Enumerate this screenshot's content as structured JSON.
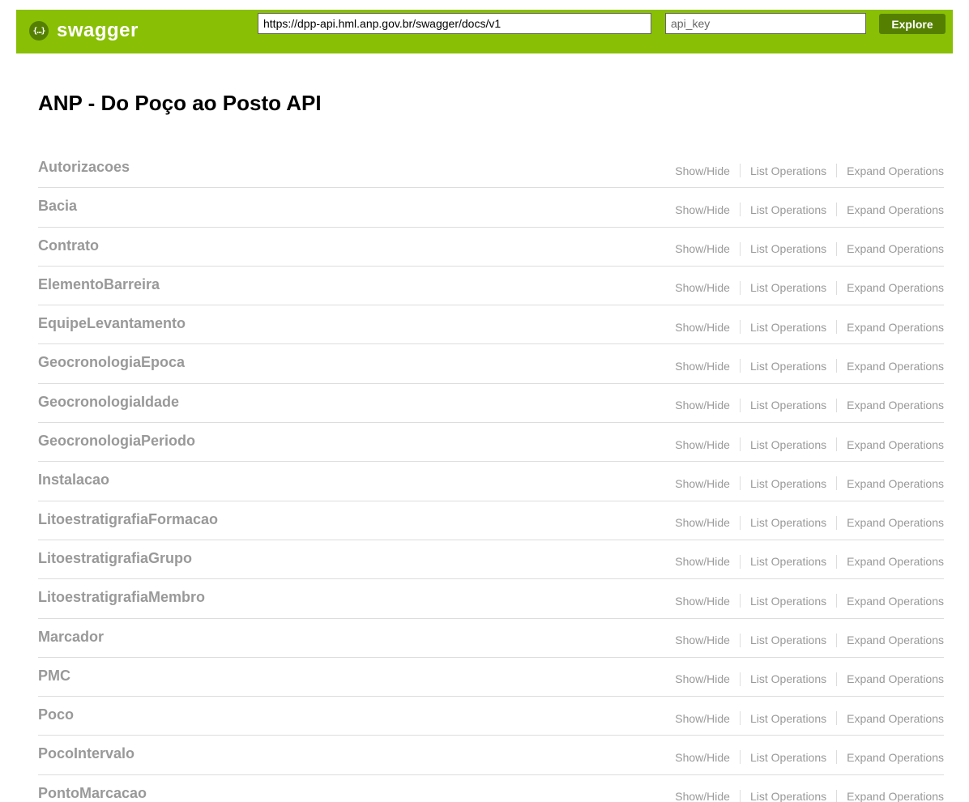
{
  "header": {
    "logo_text": "swagger",
    "logo_icon_text": "{…}",
    "url_value": "https://dpp-api.hml.anp.gov.br/swagger/docs/v1",
    "api_key_placeholder": "api_key",
    "explore_label": "Explore",
    "bar_color": "#89bf04",
    "accent_color": "#547f00"
  },
  "title": "ANP - Do Poço ao Posto API",
  "operation_labels": {
    "show_hide": "Show/Hide",
    "list_operations": "List Operations",
    "expand_operations": "Expand Operations"
  },
  "resources": [
    "Autorizacoes",
    "Bacia",
    "Contrato",
    "ElementoBarreira",
    "EquipeLevantamento",
    "GeocronologiaEpoca",
    "GeocronologiaIdade",
    "GeocronologiaPeriodo",
    "Instalacao",
    "LitoestratigrafiaFormacao",
    "LitoestratigrafiaGrupo",
    "LitoestratigrafiaMembro",
    "Marcador",
    "PMC",
    "Poco",
    "PocoIntervalo",
    "PontoMarcacao"
  ]
}
